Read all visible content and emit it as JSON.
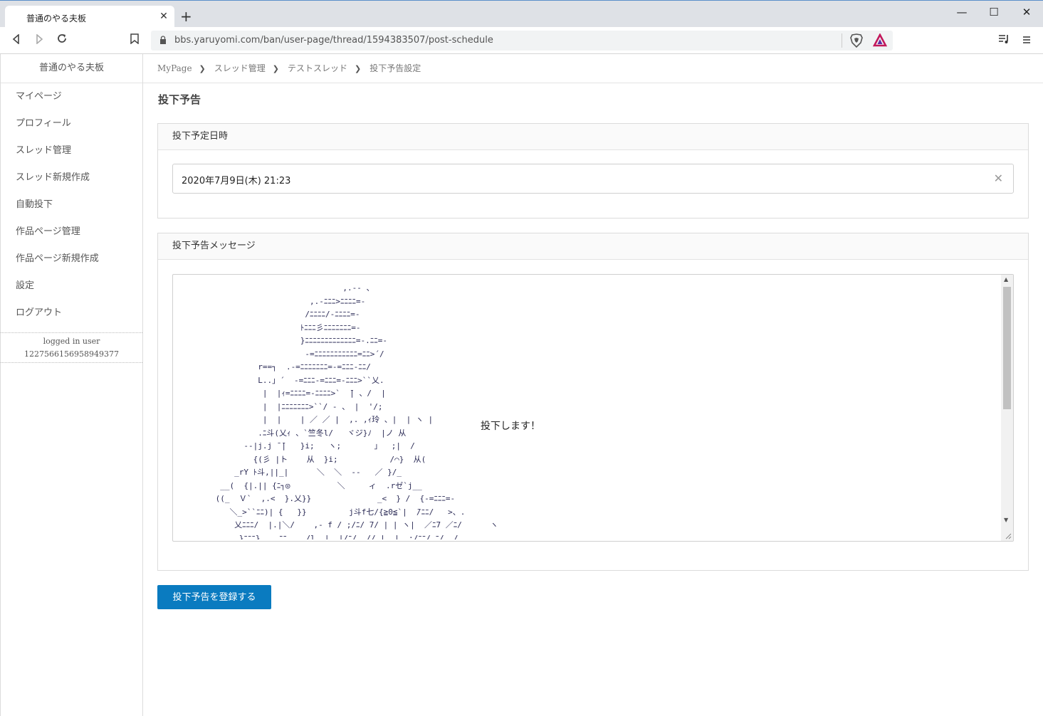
{
  "browser": {
    "tab_title": "普通のやる夫板",
    "tab_close": "✕",
    "new_tab": "+",
    "url": "bbs.yaruyomi.com/ban/user-page/thread/1594383507/post-schedule",
    "window_controls": {
      "minimize": "—",
      "maximize": "☐",
      "close": "✕"
    }
  },
  "sidebar": {
    "brand": "普通のやる夫板",
    "items": [
      {
        "label": "マイページ"
      },
      {
        "label": "プロフィール"
      },
      {
        "label": "スレッド管理"
      },
      {
        "label": "スレッド新規作成"
      },
      {
        "label": "自動投下"
      },
      {
        "label": "作品ページ管理"
      },
      {
        "label": "作品ページ新規作成"
      },
      {
        "label": "設定"
      },
      {
        "label": "ログアウト"
      }
    ],
    "user": {
      "caption": "logged in user",
      "id": "1227566156958949377"
    }
  },
  "breadcrumb": [
    "MyPage",
    "スレッド管理",
    "テストスレッド",
    "投下予告設定"
  ],
  "page_title": "投下予告",
  "schedule_card": {
    "header": "投下予定日時",
    "date_value": "2020年7月9日(木) 21:23"
  },
  "message_card": {
    "header": "投下予告メッセージ",
    "aa_text": "                                    ,.-‐ 、\n                             ,.-ﾆﾆﾆ>ﾆﾆﾆﾆ=-\n                            /ﾆﾆﾆﾆ/-ﾆﾆﾆﾆ=-\n                           ﾄﾆﾆﾆ彡ﾆﾆﾆﾆﾆﾆﾆ=-\n                           }ﾆﾆﾆﾆﾆﾆﾆﾆﾆﾆﾆﾆﾆ=-.ﾆﾆ=-\n                            -=ﾆﾆﾆﾆﾆﾆﾆﾆﾆﾆﾆ=ﾆﾆ>´/\n                  r==┐  .-=ﾆﾆﾆﾆﾆﾆﾆ=-=ﾆﾆﾆ-ﾆﾆ/\n                  L..」´  -=ﾆﾆﾆ-=ﾆﾆﾆ=-ﾆﾆﾆ>``乂.\n                   |  |ｨ=ﾆﾆﾆﾆ=-ﾆﾆﾆﾆ>`  ̄| 、/  |\n                   |  |ﾆﾆﾆﾆﾆﾆﾆ>``/ - 、 |  '/;\n                   |  |    | ／ ／ |  ,. ,ｨ玲 、|  | ヽ |\n                  .ﾆ斗(乂ｨ 、`竺冬l/   ヾジ}ﾉ  |ノ 从\n               --|j.j ̄ ̄|   }i;   ヽ;       」  ;|  /\n                 {(彡 |ト    从  }i;           /⌒}  从(\n             _rY ﾄ斗,||_|      ＼  ＼  --   ／ }/_\n          __(  {|.|| {ﾆ┐◎          ＼     ィ  .rゼ`j__\n         ((_  Ｖ`  ,.<  }.乂}}              _<  } /  {-=ﾆﾆﾆ=-\n            ＼_>``ﾆﾆ)| {   }}         j斗f七/{≧0≦`|  ̄/ﾆﾆ/   >、.\n             乂ﾆﾆﾆ/  |.|＼/    ,- f / ;/ﾆ/ 7/ | | ヽ|  ／ﾆ7 ／ﾆ/      ヽ\n              }ﾆﾆﾆ}    ﾆﾆ    /l  |  |/ﾆ/  // |  |  ;/ﾆﾆ/ ﾆ/  /    ,",
    "aa_message": "投下します！"
  },
  "submit_label": "投下予告を登録する"
}
